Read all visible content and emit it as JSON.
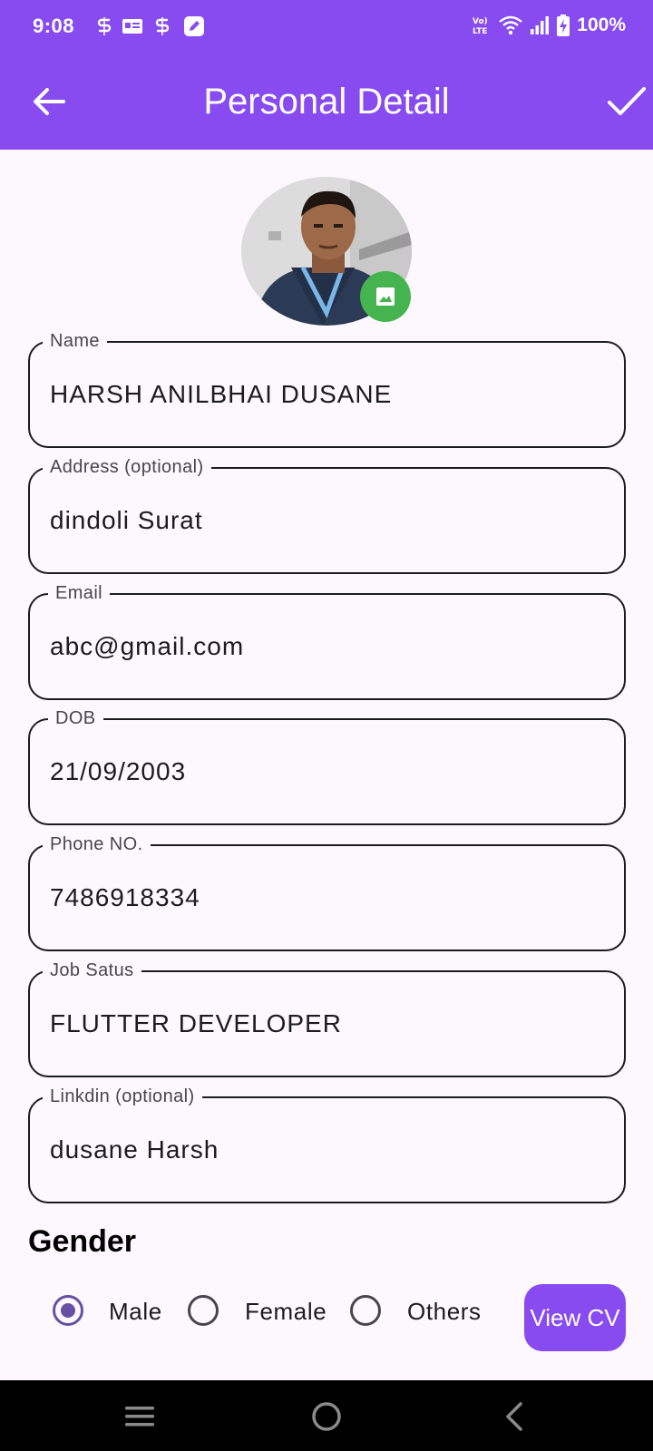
{
  "status_bar": {
    "time": "9:08",
    "battery": "100%",
    "network_label": "Vo) LTE",
    "notification_icons": [
      "sync-icon",
      "id-card-icon",
      "sync-icon",
      "edit-app-icon"
    ]
  },
  "app_bar": {
    "title": "Personal Detail",
    "back_icon": "arrow-back-icon",
    "confirm_icon": "check-icon"
  },
  "profile": {
    "photo": "profile-photo",
    "change_photo_icon": "image-icon"
  },
  "fields": {
    "name": {
      "label": "Name",
      "value": "HARSH ANILBHAI DUSANE"
    },
    "address": {
      "label": "Address (optional)",
      "value": "dindoli Surat"
    },
    "email": {
      "label": "Email",
      "value": "abc@gmail.com"
    },
    "dob": {
      "label": "DOB",
      "value": "21/09/2003"
    },
    "phone": {
      "label": "Phone NO.",
      "value": "7486918334"
    },
    "job_status": {
      "label": "Job Satus",
      "value": "FLUTTER DEVELOPER"
    },
    "linkedin": {
      "label": "Linkdin (optional)",
      "value": "dusane Harsh"
    }
  },
  "gender": {
    "title": "Gender",
    "options": [
      "Male",
      "Female",
      "Others"
    ],
    "selected": "Male"
  },
  "actions": {
    "view_cv": "View CV"
  },
  "colors": {
    "primary": "#874bf0",
    "radio_selected": "#6750a4",
    "photo_button": "#45b44f",
    "background": "#fdf8fd"
  },
  "nav_bar": {
    "icons": [
      "menu-icon",
      "home-icon",
      "back-icon"
    ]
  }
}
